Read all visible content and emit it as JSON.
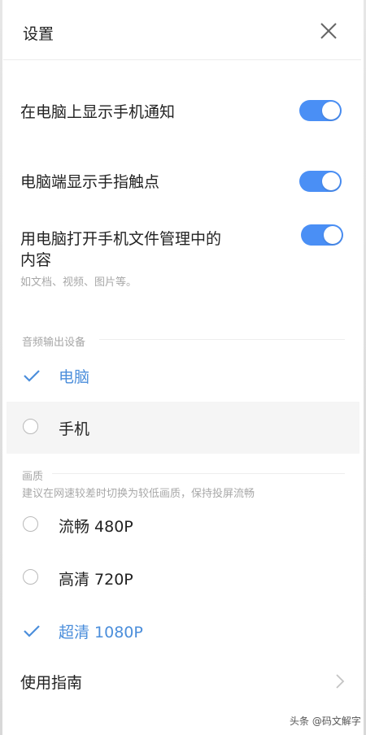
{
  "header": {
    "title": "设置",
    "close_icon": "close-icon"
  },
  "toggles": [
    {
      "label": "在电脑上显示手机通知",
      "on": true
    },
    {
      "label": "电脑端显示手指触点",
      "on": true
    },
    {
      "label_line1": "用电脑打开手机文件管理中的",
      "label_line2": "内容",
      "sub": "如文档、视频、图片等。",
      "on": true
    }
  ],
  "audio": {
    "title": "音频输出设备",
    "options": [
      {
        "label": "电脑",
        "selected": true
      },
      {
        "label": "手机",
        "selected": false
      }
    ]
  },
  "quality": {
    "title": "画质",
    "desc": "建议在网速较差时切换为较低画质，保持投屏流畅",
    "options": [
      {
        "label": "流畅 480P",
        "selected": false
      },
      {
        "label": "高清 720P",
        "selected": false
      },
      {
        "label": "超清 1080P",
        "selected": true
      }
    ]
  },
  "guide": {
    "label": "使用指南",
    "icon": "chevron-right-icon"
  },
  "watermark": "头条 @码文解字",
  "colors": {
    "accent": "#4a8ff5",
    "selected_text": "#4b8edb",
    "muted": "#a8a8a8"
  }
}
